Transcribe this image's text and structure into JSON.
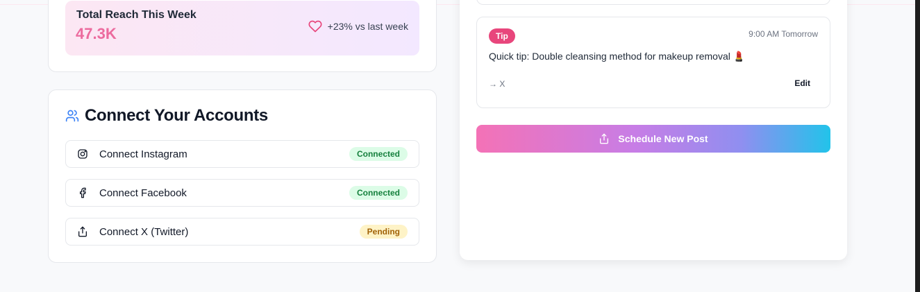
{
  "reach": {
    "title": "Total Reach This Week",
    "value": "47.3K",
    "change": "+23% vs last week",
    "icon": "heart-icon"
  },
  "accounts": {
    "title": "Connect Your Accounts",
    "icon": "users-icon",
    "items": [
      {
        "label": "Connect Instagram",
        "status": "Connected",
        "icon": "instagram-icon"
      },
      {
        "label": "Connect Facebook",
        "status": "Connected",
        "icon": "facebook-icon"
      },
      {
        "label": "Connect X (Twitter)",
        "status": "Pending",
        "icon": "share-icon"
      }
    ]
  },
  "schedule": {
    "post": {
      "tag": "Tip",
      "time": "9:00 AM Tomorrow",
      "text": "Quick tip: Double cleansing method for makeup removal 💄",
      "target": "→ X",
      "edit_label": "Edit"
    },
    "button_label": "Schedule New Post"
  },
  "colors": {
    "accent_pink": "#ec6b9e",
    "tag_pink": "#e8467c",
    "connected_bg": "#dcfce7",
    "pending_bg": "#fef3c7"
  }
}
